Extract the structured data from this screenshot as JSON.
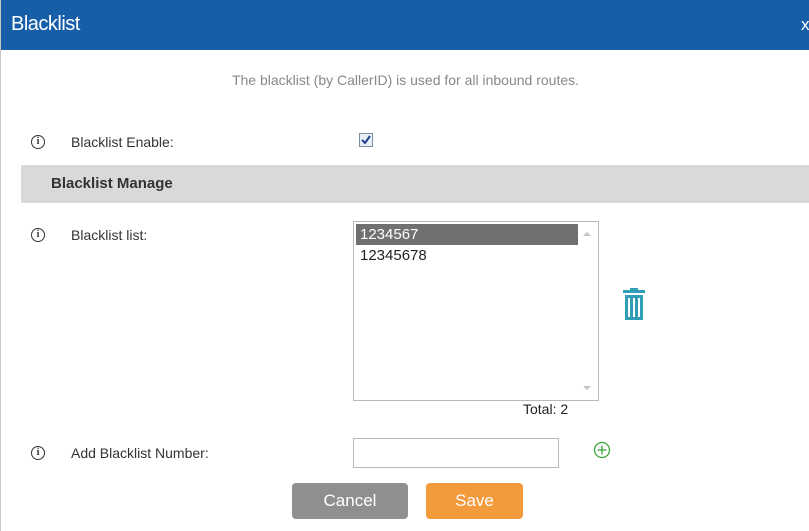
{
  "dialog": {
    "title": "Blacklist",
    "close_label": "x",
    "note": "The blacklist (by CallerID) is used for all inbound routes."
  },
  "fields": {
    "enable_label": "Blacklist Enable:",
    "enable_checked": true,
    "list_label": "Blacklist list:",
    "add_label": "Add Blacklist Number:"
  },
  "section": {
    "title": "Blacklist Manage"
  },
  "blacklist": {
    "items": [
      "1234567",
      "12345678"
    ],
    "selected_index": 0,
    "total_text": "Total: 2"
  },
  "add_number": {
    "value": "",
    "placeholder": ""
  },
  "buttons": {
    "cancel": "Cancel",
    "save": "Save"
  },
  "colors": {
    "titlebar": "#175ea9",
    "section_bg": "#d9d9d9",
    "selected_item": "#707070",
    "save_button": "#f39a3c",
    "cancel_button": "#8f8f8f",
    "icon_teal": "#2f9db5",
    "add_icon_green": "#3aa63a"
  },
  "icons": {
    "info": "info-icon",
    "trash": "trash-icon",
    "add": "plus-circle-icon",
    "checkbox_check": "check-icon"
  }
}
